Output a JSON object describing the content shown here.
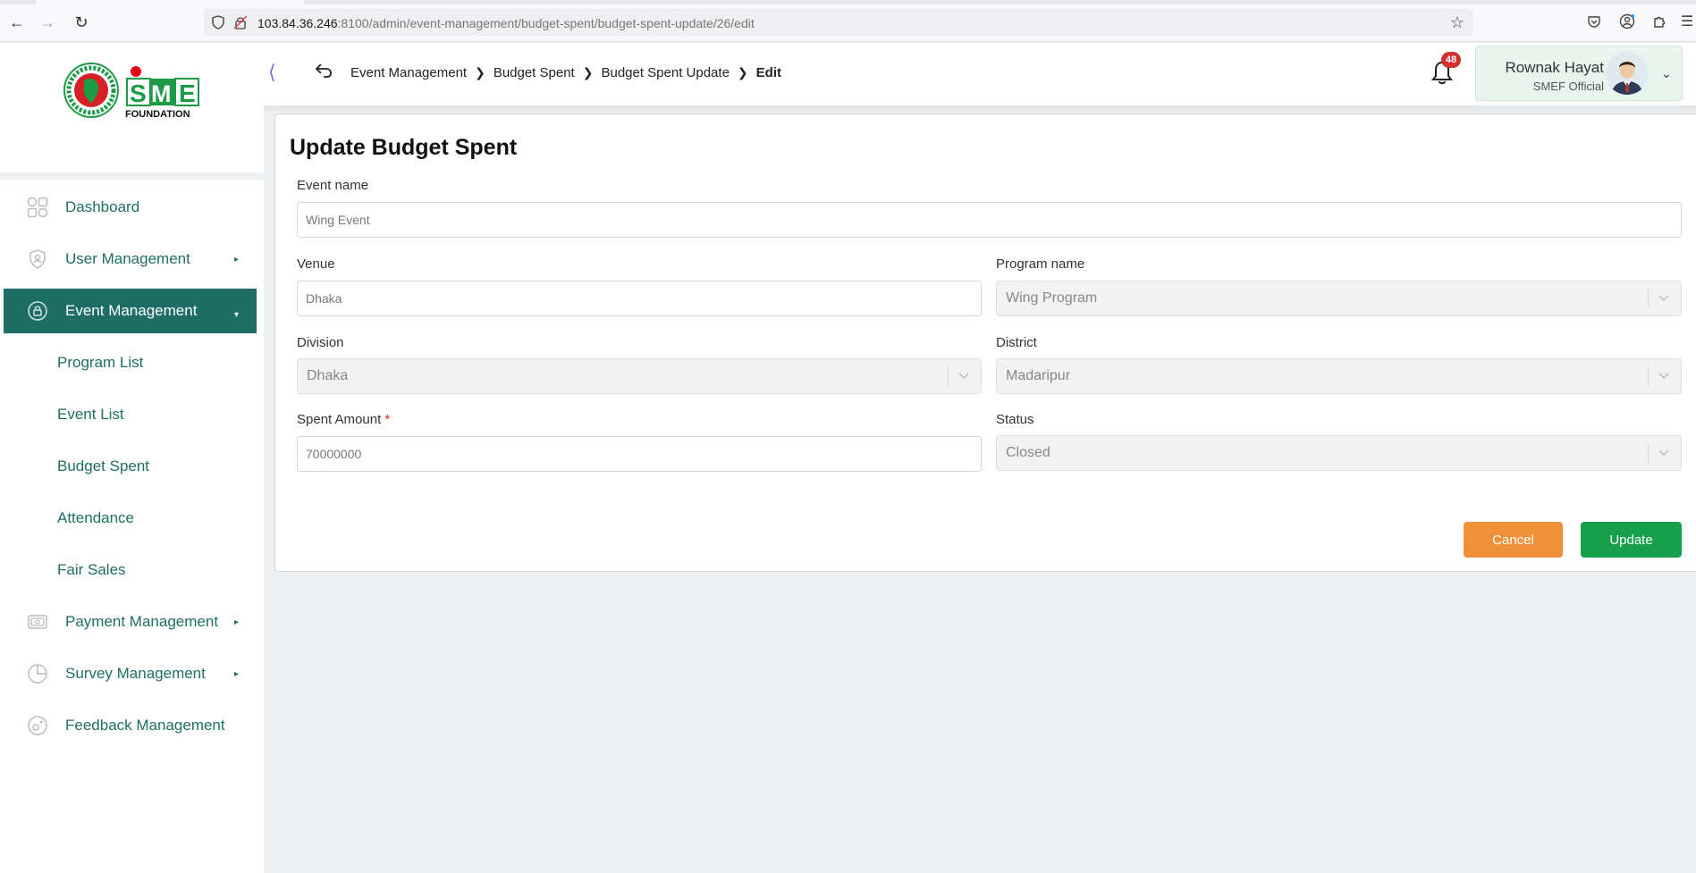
{
  "browser": {
    "url_host": "103.84.36.246",
    "url_rest": ":8100/admin/event-management/budget-spent/budget-spent-update/26/edit"
  },
  "sidebar": {
    "items": [
      {
        "label": "Dashboard",
        "icon": "dashboard-grid-icon"
      },
      {
        "label": "User Management",
        "icon": "shield-user-icon"
      },
      {
        "label": "Event Management",
        "icon": "lock-circle-icon"
      },
      {
        "label": "Payment Management",
        "icon": "cash-icon"
      },
      {
        "label": "Survey Management",
        "icon": "pie-chart-icon"
      },
      {
        "label": "Feedback Management",
        "icon": "feedback-icon"
      }
    ],
    "event_submenu": [
      {
        "label": "Program List"
      },
      {
        "label": "Event List"
      },
      {
        "label": "Budget Spent"
      },
      {
        "label": "Attendance"
      },
      {
        "label": "Fair Sales"
      }
    ]
  },
  "logo": {
    "brand": "SME",
    "sub": "FOUNDATION"
  },
  "header": {
    "breadcrumb": [
      "Event Management",
      "Budget Spent",
      "Budget Spent Update",
      "Edit"
    ],
    "notification_count": "48",
    "user_name": "Rownak Hayat",
    "user_role": "SMEF Official"
  },
  "form": {
    "title": "Update Budget Spent",
    "event_name_label": "Event name",
    "event_name_value": "Wing Event",
    "venue_label": "Venue",
    "venue_value": "Dhaka",
    "program_label": "Program name",
    "program_value": "Wing Program",
    "division_label": "Division",
    "division_value": "Dhaka",
    "district_label": "District",
    "district_value": "Madaripur",
    "amount_label": "Spent Amount",
    "amount_required": "*",
    "amount_value": "70000000",
    "status_label": "Status",
    "status_value": "Closed",
    "cancel_label": "Cancel",
    "update_label": "Update"
  },
  "colors": {
    "primary": "#1f6e66",
    "cancel": "#f0913a",
    "update": "#16a04b",
    "badge": "#d32f2f"
  }
}
